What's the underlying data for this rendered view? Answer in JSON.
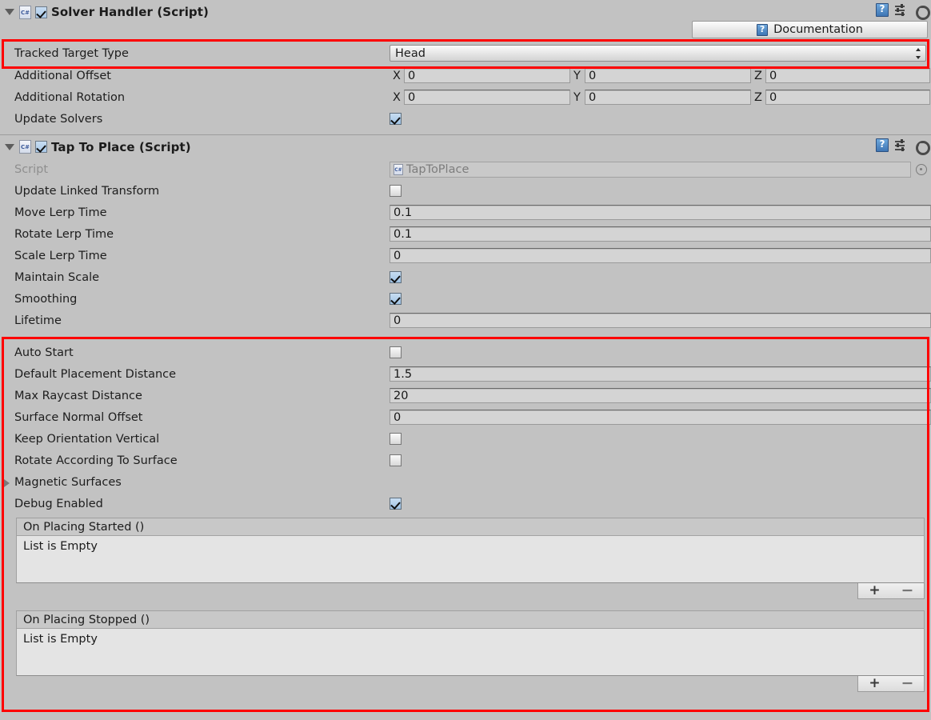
{
  "solver_handler": {
    "title": "Solver Handler (Script)",
    "enabled": true,
    "documentation_label": "Documentation",
    "icons": {
      "help": "help-book-icon",
      "preset": "preset-icon",
      "gear": "gear-icon"
    },
    "rows": [
      {
        "label": "Tracked Target Type",
        "type": "enum",
        "value": "Head"
      },
      {
        "label": "Additional Offset",
        "type": "vector3",
        "x": "0",
        "y": "0",
        "z": "0",
        "axis_labels": [
          "X",
          "Y",
          "Z"
        ]
      },
      {
        "label": "Additional Rotation",
        "type": "vector3",
        "x": "0",
        "y": "0",
        "z": "0",
        "axis_labels": [
          "X",
          "Y",
          "Z"
        ]
      },
      {
        "label": "Update Solvers",
        "type": "bool",
        "value": true
      }
    ]
  },
  "tap_to_place": {
    "title": "Tap To Place (Script)",
    "enabled": true,
    "icons": {
      "help": "help-book-icon",
      "preset": "preset-icon",
      "gear": "gear-icon"
    },
    "script_row": {
      "label": "Script",
      "value": "TapToPlace"
    },
    "rows": [
      {
        "label": "Update Linked Transform",
        "type": "bool",
        "value": false
      },
      {
        "label": "Move Lerp Time",
        "type": "number",
        "value": "0.1"
      },
      {
        "label": "Rotate Lerp Time",
        "type": "number",
        "value": "0.1"
      },
      {
        "label": "Scale Lerp Time",
        "type": "number",
        "value": "0"
      },
      {
        "label": "Maintain Scale",
        "type": "bool",
        "value": true
      },
      {
        "label": "Smoothing",
        "type": "bool",
        "value": true
      },
      {
        "label": "Lifetime",
        "type": "number",
        "value": "0"
      }
    ],
    "highlighted_rows": [
      {
        "label": "Auto Start",
        "type": "bool",
        "value": false
      },
      {
        "label": "Default Placement Distance",
        "type": "number",
        "value": "1.5"
      },
      {
        "label": "Max Raycast Distance",
        "type": "number",
        "value": "20"
      },
      {
        "label": "Surface Normal Offset",
        "type": "number",
        "value": "0"
      },
      {
        "label": "Keep Orientation Vertical",
        "type": "bool",
        "value": false
      },
      {
        "label": "Rotate According To Surface",
        "type": "bool",
        "value": false
      },
      {
        "label": "Magnetic Surfaces",
        "type": "foldout",
        "expanded": false
      },
      {
        "label": "Debug Enabled",
        "type": "bool",
        "value": true
      }
    ],
    "events": [
      {
        "header": "On Placing Started ()",
        "empty_text": "List is Empty",
        "add_label": "+",
        "remove_label": "−"
      },
      {
        "header": "On Placing Stopped ()",
        "empty_text": "List is Empty",
        "add_label": "+",
        "remove_label": "−"
      }
    ]
  },
  "colors": {
    "background": "#c2c2c2",
    "highlight": "#ff0000",
    "field": "#d4d4d4",
    "event_body": "#e4e4e4"
  }
}
